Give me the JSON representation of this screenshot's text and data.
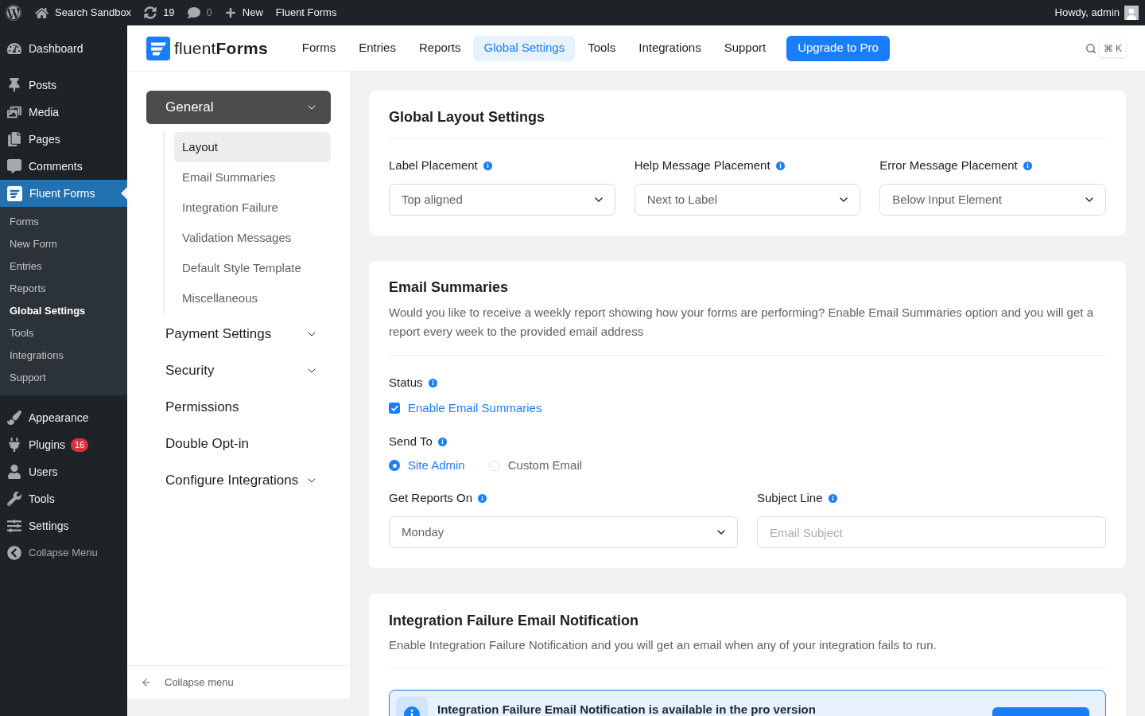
{
  "admin_bar": {
    "site": "Search Sandbox",
    "updates": "19",
    "comments": "0",
    "new": "New",
    "plugin": "Fluent Forms",
    "greeting": "Howdy, admin"
  },
  "sidebar": {
    "groups": [
      [
        {
          "label": "Dashboard",
          "selected": false
        }
      ],
      [
        {
          "label": "Posts",
          "selected": false
        },
        {
          "label": "Media",
          "selected": false
        },
        {
          "label": "Pages",
          "selected": false
        },
        {
          "label": "Comments",
          "selected": false
        },
        {
          "label": "Fluent Forms",
          "selected": true,
          "children": [
            {
              "label": "Forms",
              "selected": false
            },
            {
              "label": "New Form",
              "selected": false
            },
            {
              "label": "Entries",
              "selected": false
            },
            {
              "label": "Reports",
              "selected": false
            },
            {
              "label": "Global Settings",
              "selected": true
            },
            {
              "label": "Tools",
              "selected": false
            },
            {
              "label": "Integrations",
              "selected": false
            },
            {
              "label": "Support",
              "selected": false
            }
          ]
        }
      ],
      [
        {
          "label": "Appearance",
          "selected": false
        },
        {
          "label": "Plugins",
          "selected": false,
          "badge": "16"
        },
        {
          "label": "Users",
          "selected": false
        },
        {
          "label": "Tools",
          "selected": false
        },
        {
          "label": "Settings",
          "selected": false
        }
      ]
    ],
    "collapse": "Collapse Menu"
  },
  "header": {
    "logo": "fluent**Forms**",
    "nav": [
      {
        "label": "Forms",
        "selected": false
      },
      {
        "label": "Entries",
        "selected": false
      },
      {
        "label": "Reports",
        "selected": false
      },
      {
        "label": "Global Settings",
        "selected": true
      },
      {
        "label": "Tools",
        "selected": false
      },
      {
        "label": "Integrations",
        "selected": false
      },
      {
        "label": "Support",
        "selected": false
      }
    ],
    "upgrade": "Upgrade to Pro",
    "shortcut": "⌘ K"
  },
  "settings_nav": {
    "items": [
      {
        "kind": "group",
        "label": "General",
        "expanded": true,
        "children": [
          {
            "label": "Layout",
            "selected": true
          },
          {
            "label": "Email Summaries",
            "selected": false
          },
          {
            "label": "Integration Failure",
            "selected": false
          },
          {
            "label": "Validation Messages",
            "selected": false
          },
          {
            "label": "Default Style Template",
            "selected": false
          },
          {
            "label": "Miscellaneous",
            "selected": false
          }
        ]
      },
      {
        "kind": "group",
        "label": "Payment Settings",
        "expanded": false
      },
      {
        "kind": "group",
        "label": "Security",
        "expanded": false
      },
      {
        "kind": "link",
        "label": "Permissions"
      },
      {
        "kind": "link",
        "label": "Double Opt-in"
      },
      {
        "kind": "group",
        "label": "Configure Integrations",
        "expanded": false
      }
    ],
    "collapse": "Collapse menu"
  },
  "layout_card": {
    "title": "Global Layout Settings",
    "fields": [
      {
        "label": "Label Placement",
        "value": "Top aligned"
      },
      {
        "label": "Help Message Placement",
        "value": "Next to Label"
      },
      {
        "label": "Error Message Placement",
        "value": "Below Input Element"
      }
    ]
  },
  "email_card": {
    "title": "Email Summaries",
    "description": "Would you like to receive a weekly report showing how your forms are performing? Enable Email Summaries option and you will get a report every week to the provided email address",
    "status": {
      "label": "Status",
      "checkbox": {
        "label": "Enable Email Summaries",
        "checked": true
      }
    },
    "send_to": {
      "label": "Send To",
      "options": [
        {
          "label": "Site Admin",
          "selected": true
        },
        {
          "label": "Custom Email",
          "selected": false
        }
      ]
    },
    "fields": [
      {
        "kind": "select",
        "label": "Get Reports On",
        "value": "Monday"
      },
      {
        "kind": "input",
        "label": "Subject Line",
        "placeholder": "Email Subject"
      }
    ]
  },
  "integration_card": {
    "title": "Integration Failure Email Notification",
    "description": "Enable Integration Failure Notification and you will get an email when any of your integration fails to run.",
    "notice": "Integration Failure Email Notification is available in the pro version"
  }
}
